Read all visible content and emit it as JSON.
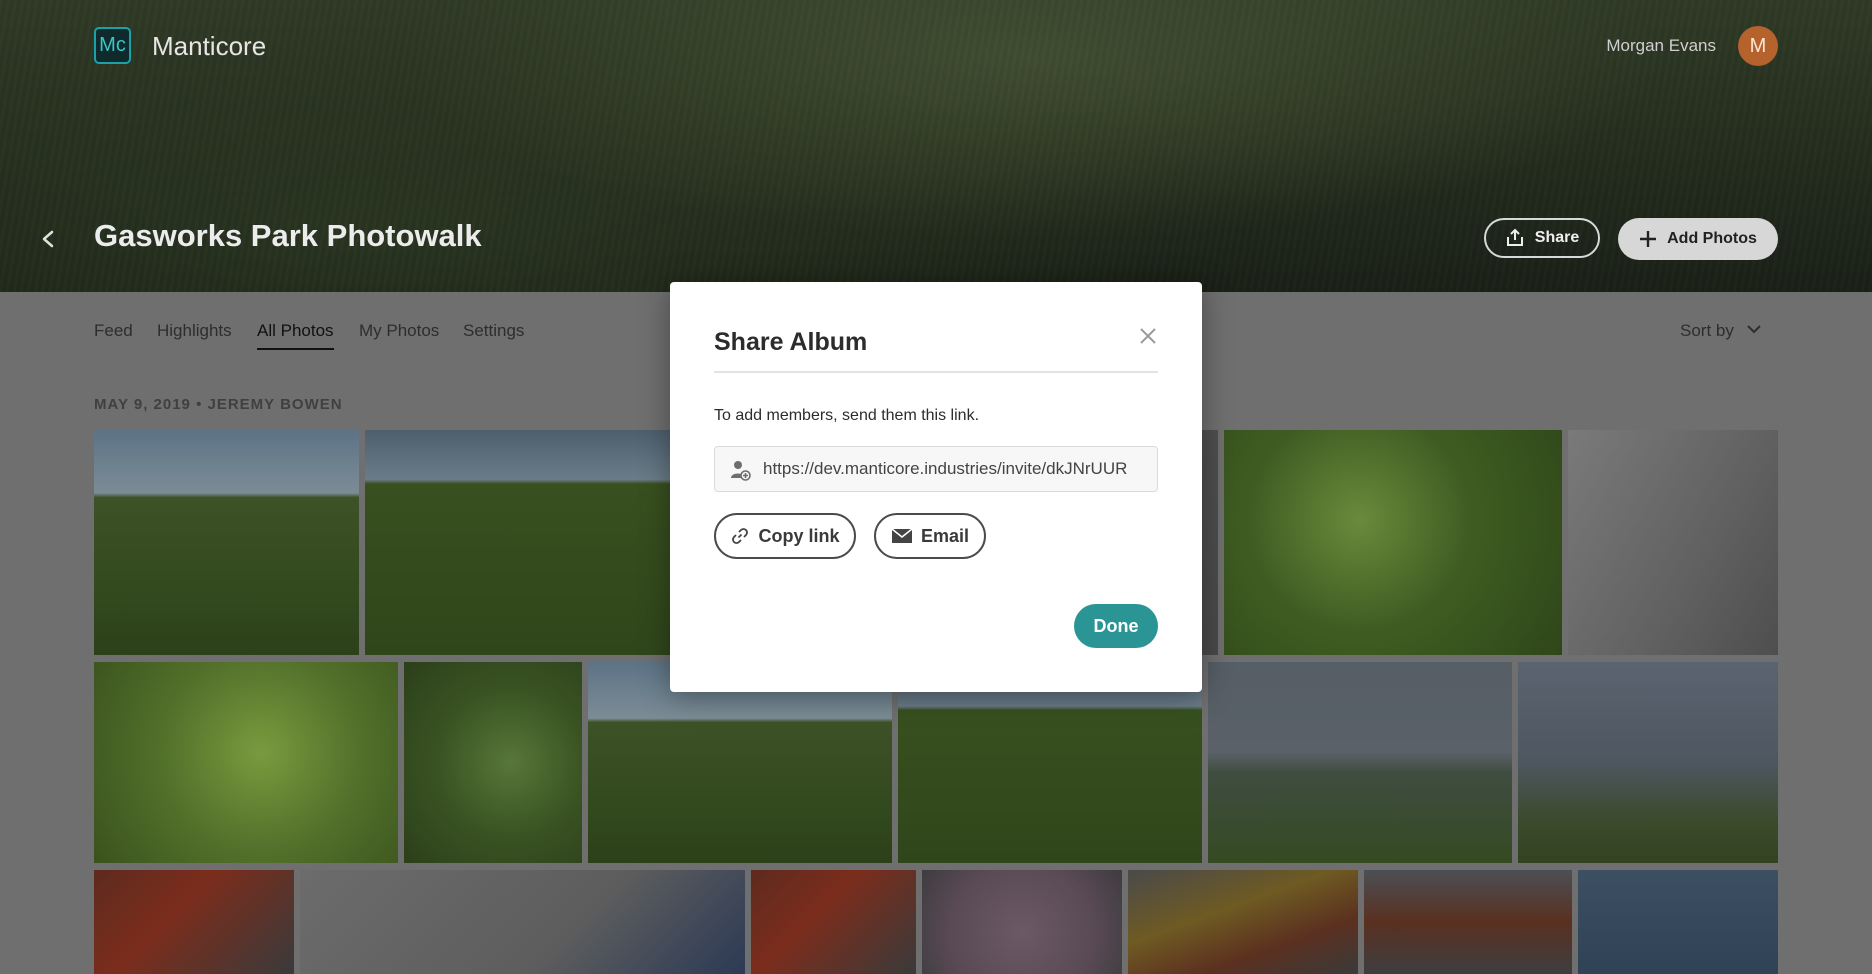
{
  "app": {
    "logo_text": "Mc",
    "name": "Manticore"
  },
  "user": {
    "name": "Morgan Evans",
    "avatar_initial": "M"
  },
  "album": {
    "title": "Gasworks Park Photowalk",
    "share_label": "Share",
    "add_photos_label": "Add Photos"
  },
  "nav": {
    "tabs": [
      {
        "label": "Feed",
        "active": false
      },
      {
        "label": "Highlights",
        "active": false
      },
      {
        "label": "All Photos",
        "active": true
      },
      {
        "label": "My Photos",
        "active": false
      },
      {
        "label": "Settings",
        "active": false
      }
    ],
    "sort_label": "Sort by"
  },
  "feed": {
    "date_label": "MAY 9, 2019 • JEREMY BOWEN"
  },
  "modal": {
    "title": "Share Album",
    "description": "To add members, send them this link.",
    "link_value": "https://dev.manticore.industries/invite/dkJNrUUR",
    "copy_link_label": "Copy link",
    "email_label": "Email",
    "done_label": "Done"
  },
  "colors": {
    "accent": "#2b9595",
    "logo_teal": "#1aa3a6",
    "avatar": "#b5622d"
  },
  "icons": {
    "back": "chevron-left-icon",
    "share": "share-icon",
    "add": "plus-icon",
    "sort": "chevron-down-icon",
    "close": "close-icon",
    "link_field": "add-user-icon",
    "copy": "link-icon",
    "email": "envelope-icon"
  }
}
